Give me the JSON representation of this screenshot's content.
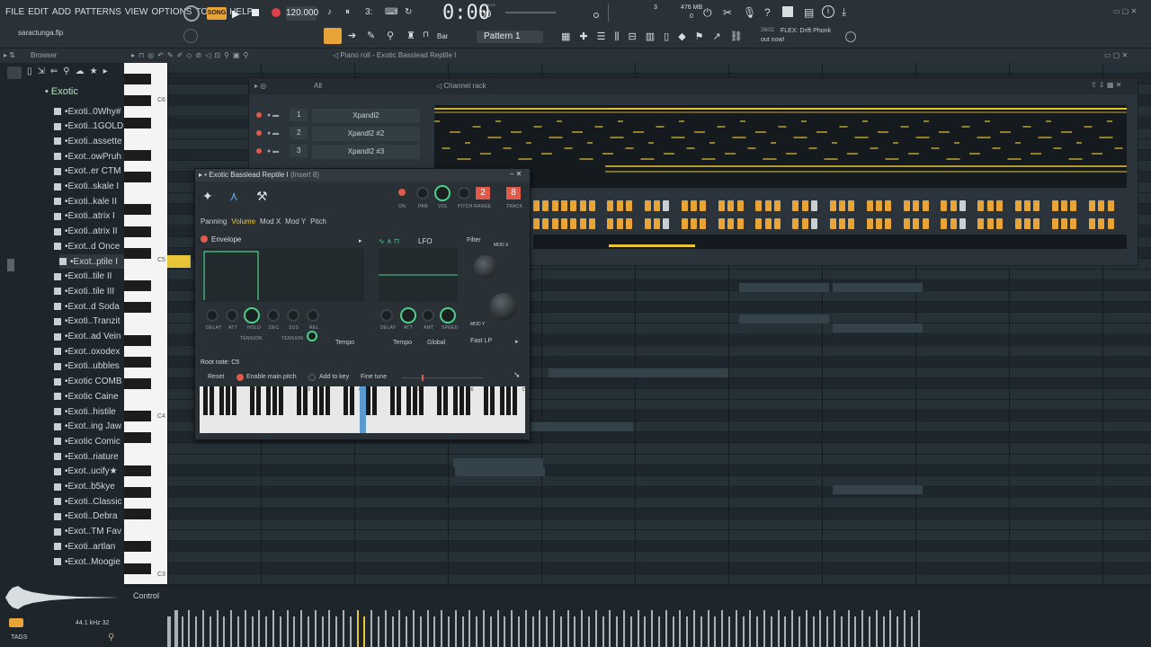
{
  "menu": [
    "FILE",
    "EDIT",
    "ADD",
    "PATTERNS",
    "VIEW",
    "OPTIONS",
    "TOOLS",
    "HELP"
  ],
  "transport": {
    "mode": "SONG",
    "tempo": "120.000",
    "time": "0:00",
    "time_small": "00",
    "time_caption": "M:S:CS",
    "mem": "476 MB",
    "cpu_top": "3",
    "cpu_bottom": "0"
  },
  "toolbar2": {
    "file": "saractunga.flp",
    "snap": "Bar",
    "pattern": "Pattern 1",
    "news_date": "26/02",
    "news_title": "FLEX: Drift Phonk",
    "news_sub": "out now!"
  },
  "browser": {
    "title": "Browser",
    "folder": "Exotic",
    "items": [
      "Exoti..0Why#",
      "Exoti..1GOLD",
      "Exoti..assette",
      "Exot..owPruh",
      "Exot..er CTM",
      "Exoti..skale I",
      "Exoti..kale II",
      "Exoti..atrix I",
      "Exoti..atrix II",
      "Exot..d Once",
      "Exot..ptile I",
      "Exoti..tile II",
      "Exoti..tile III",
      "Exot..d Soda",
      "Exoti..Tranzit",
      "Exot..ad Vein",
      "Exot..oxodex",
      "Exoti..ubbles",
      "Exotic COMB",
      "Exotic Caine",
      "Exoti..histile",
      "Exot..ing Jaw",
      "Exotic Comic",
      "Exoti..riature",
      "Exot..ucify★",
      "Exot..b5kye",
      "Exoti..Classic",
      "Exoti..Debra",
      "Exot..TM Fav",
      "Exoti..artlan",
      "Exot..Moogie"
    ],
    "selected_index": 10,
    "sample_rate": "44.1 kHz 32",
    "tags": "TAGS"
  },
  "pianoroll": {
    "title": "Piano roll",
    "target": "Exotic Basslead Reptile I",
    "key_labels": [
      "C6",
      "C5",
      "C4",
      "C3"
    ],
    "marker": "C5"
  },
  "channelrack": {
    "filter": "All",
    "title": "Channel rack",
    "channels": [
      {
        "num": "1",
        "name": "Xpandl2"
      },
      {
        "num": "2",
        "name": "Xpandl2 #2"
      },
      {
        "num": "3",
        "name": "Xpandl2 #3"
      }
    ]
  },
  "plugin": {
    "title": "Exotic Basslead Reptile I",
    "insert": "(Insert 8)",
    "tabs": [
      "Panning",
      "Volume",
      "Mod X",
      "Mod Y",
      "Pitch"
    ],
    "active_tab": "Volume",
    "top_knobs": [
      "ON",
      "PAN",
      "VOL",
      "PITCH",
      "RANGE",
      "TRACK"
    ],
    "range_val": "2",
    "track_val": "8",
    "envelope": "Envelope",
    "env_knobs": [
      "DELAY",
      "ATT",
      "HOLD",
      "DEC",
      "SUS",
      "REL"
    ],
    "tension": "TENSION",
    "lfo": "LFO",
    "lfo_knobs": [
      "DELAY",
      "ATT",
      "AMT",
      "SPEED"
    ],
    "filter": "Filter",
    "modx": "MOD X",
    "mody": "MOD Y",
    "tempo": "Tempo",
    "global": "Global",
    "filter_type": "Fast LP",
    "root_note": "Root note: C5",
    "reset": "Reset",
    "enable_pitch": "Enable main pitch",
    "add_key": "Add to key",
    "fine_tune": "Fine tune",
    "kb_labels": [
      "C2",
      "C3",
      "C4",
      "C5",
      "C6",
      "C7"
    ]
  },
  "bottom": {
    "control": "Control"
  },
  "colors": {
    "accent": "#e8a436",
    "green": "#4ed08a",
    "red": "#e0404a",
    "bg": "#1a2228"
  }
}
